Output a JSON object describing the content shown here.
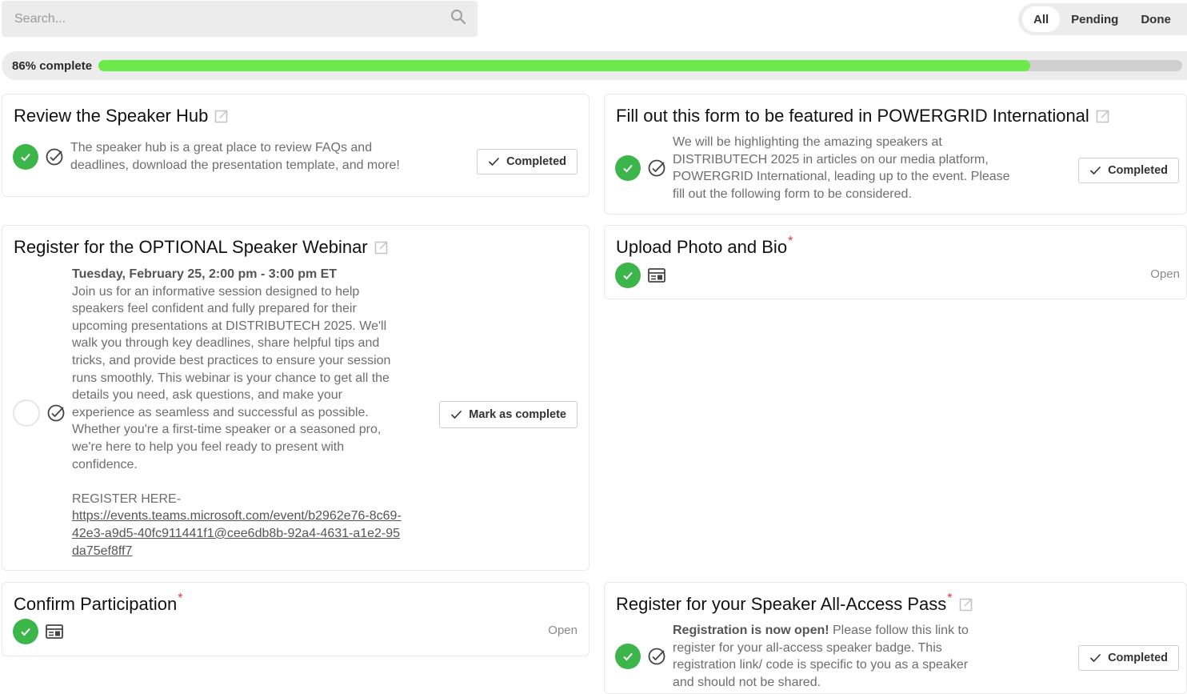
{
  "search": {
    "placeholder": "Search..."
  },
  "filters": [
    {
      "label": "All",
      "active": true
    },
    {
      "label": "Pending",
      "active": false
    },
    {
      "label": "Done",
      "active": false
    }
  ],
  "progress": {
    "label": "86% complete",
    "percent": 86
  },
  "colors": {
    "accent_green": "#3cb54a",
    "progress_green": "#6de94a",
    "required_red": "#e53935"
  },
  "tasks": [
    {
      "title": "Review the Speaker Hub",
      "description": "The speaker hub is a great place to review FAQs and deadlines, download the presentation template, and more!",
      "action_label": "Completed",
      "status": "done",
      "type_icon": "check-circle-icon"
    },
    {
      "title": "Fill out this form to be featured in POWERGRID International",
      "description": "We will be highlighting the amazing speakers at DISTRIBUTECH 2025 in articles on our media platform, POWERGRID International, leading up to the event. Please fill out the following form to be considered.",
      "action_label": "Completed",
      "status": "done",
      "type_icon": "check-circle-icon"
    },
    {
      "title": "Register for the OPTIONAL Speaker Webinar",
      "date_line": "Tuesday, February 25, 2:00 pm - 3:00 pm ET",
      "description": "Join us for an informative session designed to help speakers feel confident and fully prepared for their upcoming presentations at DISTRIBUTECH 2025. We'll walk you through key deadlines, share helpful tips and tricks, and provide best practices to ensure your session runs smoothly. This webinar is your chance to get all the details you need, ask questions, and make your experience as seamless and successful as possible. Whether you're a first-time speaker or a seasoned pro, we're here to help you feel ready to present with confidence.",
      "register_label": "REGISTER HERE-",
      "register_link": "https://events.teams.microsoft.com/event/b2962e76-8c69-42e3-a9d5-40fc911441f1@cee6db8b-92a4-4631-a1e2-95da75ef8ff7",
      "action_label": "Mark as complete",
      "status": "pending",
      "type_icon": "check-circle-icon"
    },
    {
      "title": "Upload Photo and Bio",
      "required_mark": "*",
      "status_text": "Open",
      "status": "done",
      "type_icon": "form-icon"
    },
    {
      "title": "Confirm Participation",
      "required_mark": "*",
      "status_text": "Open",
      "status": "done",
      "type_icon": "form-icon"
    },
    {
      "title": "Register for your Speaker All-Access Pass",
      "required_mark": "*",
      "description_bold": "Registration is now open!",
      "description": " Please follow this link to register for your all-access speaker badge. This registration link/ code is specific to you as a speaker and should not be shared.",
      "action_label": "Completed",
      "status": "done",
      "type_icon": "check-circle-icon"
    }
  ]
}
